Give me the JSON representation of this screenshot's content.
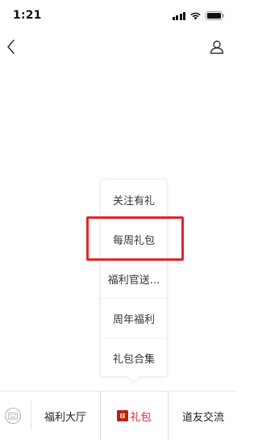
{
  "status_bar": {
    "time": "1:21"
  },
  "nav": {
    "back_icon": "chevron-left-icon",
    "profile_icon": "person-icon"
  },
  "popup_menu": {
    "items": [
      {
        "label": "关注有礼"
      },
      {
        "label": "每周礼包"
      },
      {
        "label": "福利官送..."
      },
      {
        "label": "周年福利"
      },
      {
        "label": "礼包合集"
      }
    ],
    "highlighted_item": "每周礼包",
    "highlight_color": "#e0262a"
  },
  "tab_bar": {
    "keyboard_icon": "keyboard-icon",
    "tabs": [
      {
        "label": "福利大厅"
      },
      {
        "label": "礼包",
        "icon": "gift-icon",
        "active": true
      },
      {
        "label": "道友交流"
      }
    ],
    "accent_color": "#e0262a"
  }
}
